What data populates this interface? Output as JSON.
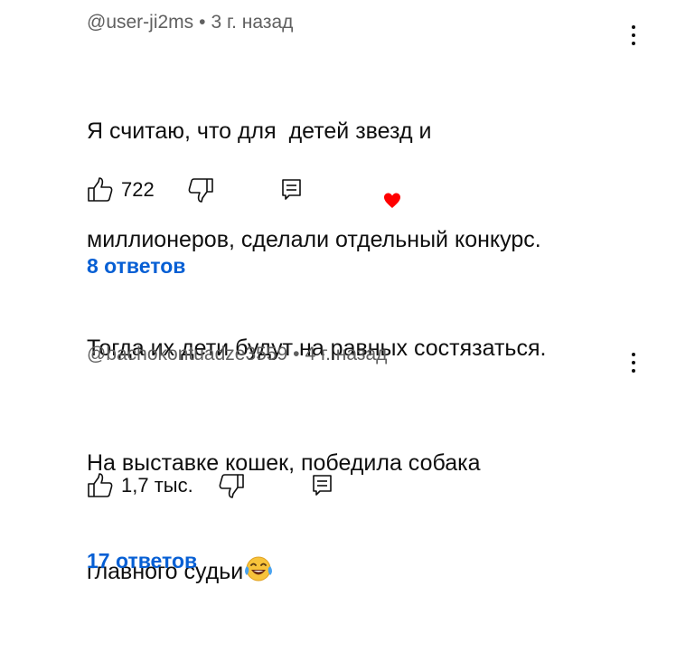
{
  "comments": [
    {
      "author": "@user-ji2ms",
      "time": "3 г. назад",
      "text_lines": [
        "Я считаю, что для  детей звезд и",
        "миллионеров, сделали отдельный конкурс.",
        "Тогда их дети будут на равных состязаться."
      ],
      "likes": "722",
      "replies": "8 ответов",
      "creator_heart": true
    },
    {
      "author": "@bachokontuadze3559",
      "time": "4 г. назад",
      "text_lines": [
        "На выставке кошек, победила собака",
        "главного судьи"
      ],
      "text_emoji": "face-with-tears-of-joy",
      "likes": "1,7 тыс.",
      "replies": "17 ответов",
      "creator_heart": false
    }
  ],
  "separator": "•",
  "colors": {
    "link": "#065fd4",
    "meta": "#606060",
    "heart": "#ff0000"
  }
}
